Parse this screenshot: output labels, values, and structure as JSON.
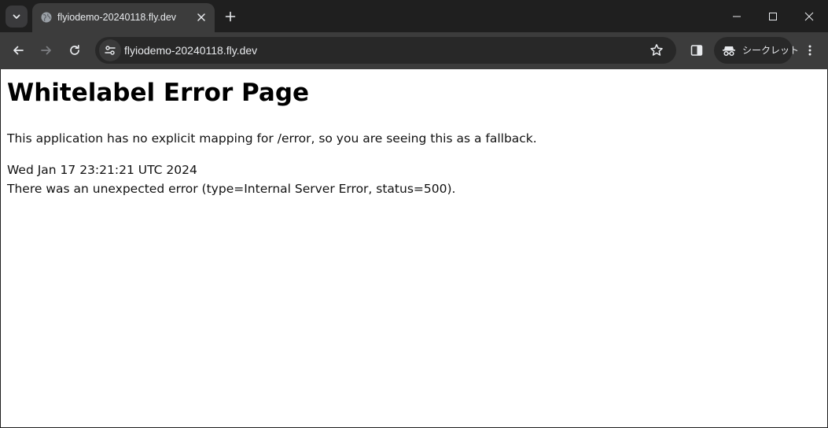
{
  "colors": {
    "titlebar": "#1f1f1f",
    "toolbar": "#3c3c3c",
    "omnibox": "#282828",
    "text_light": "#e8eaed",
    "page_background": "#ffffff"
  },
  "tabstrip": {
    "tab_search_icon": "chevron-down-icon",
    "tabs": [
      {
        "title": "flyiodemo-20240118.fly.dev",
        "favicon": "globe-icon",
        "active": true
      }
    ],
    "new_tab_icon": "plus-icon",
    "window_controls": [
      "minimize-icon",
      "maximize-icon",
      "close-icon"
    ]
  },
  "toolbar": {
    "back_icon": "arrow-left-icon",
    "forward_icon": "arrow-right-icon",
    "reload_icon": "reload-icon",
    "site_info_icon": "tune-icon",
    "url": "flyiodemo-20240118.fly.dev",
    "bookmark_icon": "star-icon",
    "side_panel_icon": "side-panel-icon",
    "incognito_label": "シークレット",
    "menu_icon": "more-vert-icon"
  },
  "page": {
    "heading": "Whitelabel Error Page",
    "description": "This application has no explicit mapping for /error, so you are seeing this as a fallback.",
    "timestamp": "Wed Jan 17 23:21:21 UTC 2024",
    "error_message": "There was an unexpected error (type=Internal Server Error, status=500)."
  }
}
